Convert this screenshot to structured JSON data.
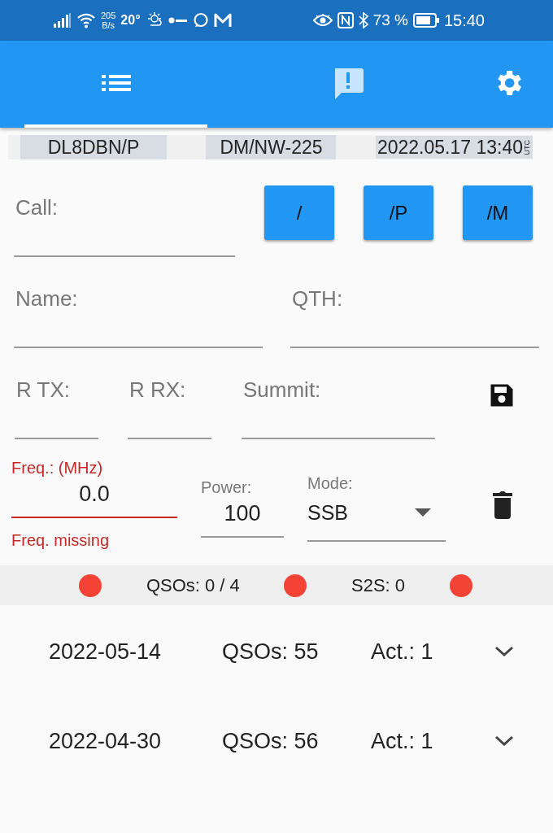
{
  "status_bar": {
    "speed_value": "205",
    "speed_unit": "B/s",
    "temperature": "20°",
    "battery": "73 %",
    "time": "15:40"
  },
  "tabs": [
    {
      "kind": "list",
      "selected": true
    },
    {
      "kind": "alert",
      "selected": false
    },
    {
      "kind": "settings",
      "selected": false
    }
  ],
  "header": {
    "callsign": "DL8DBN/P",
    "summit": "DM/NW-225",
    "datetime": "2022.05.17 13:40",
    "timezone": "UTC"
  },
  "form": {
    "call": {
      "placeholder": "Call:"
    },
    "suffix_buttons": [
      "/",
      "/P",
      "/M"
    ],
    "name": {
      "placeholder": "Name:"
    },
    "qth": {
      "placeholder": "QTH:"
    },
    "rst_tx": {
      "placeholder": "R TX:"
    },
    "rst_rx": {
      "placeholder": "R RX:"
    },
    "summit": {
      "placeholder": "Summit:"
    },
    "frequency": {
      "label": "Freq.: (MHz)",
      "value": "0.0",
      "error": "Freq. missing"
    },
    "power": {
      "label": "Power:",
      "value": "100"
    },
    "mode": {
      "label": "Mode:",
      "value": "SSB"
    }
  },
  "summary": [
    {
      "kind": "dot",
      "color": "#f44336"
    },
    {
      "kind": "text",
      "text": "QSOs: 0 / 4"
    },
    {
      "kind": "dot",
      "color": "#f44336"
    },
    {
      "kind": "text",
      "text": "S2S: 0"
    },
    {
      "kind": "dot",
      "color": "#f44336"
    }
  ],
  "days": [
    {
      "date": "2022-05-14",
      "qsos": "QSOs: 55",
      "activations": "Act.: 1",
      "expanded": false
    },
    {
      "date": "2022-04-30",
      "qsos": "QSOs: 56",
      "activations": "Act.: 1",
      "expanded": false
    }
  ]
}
